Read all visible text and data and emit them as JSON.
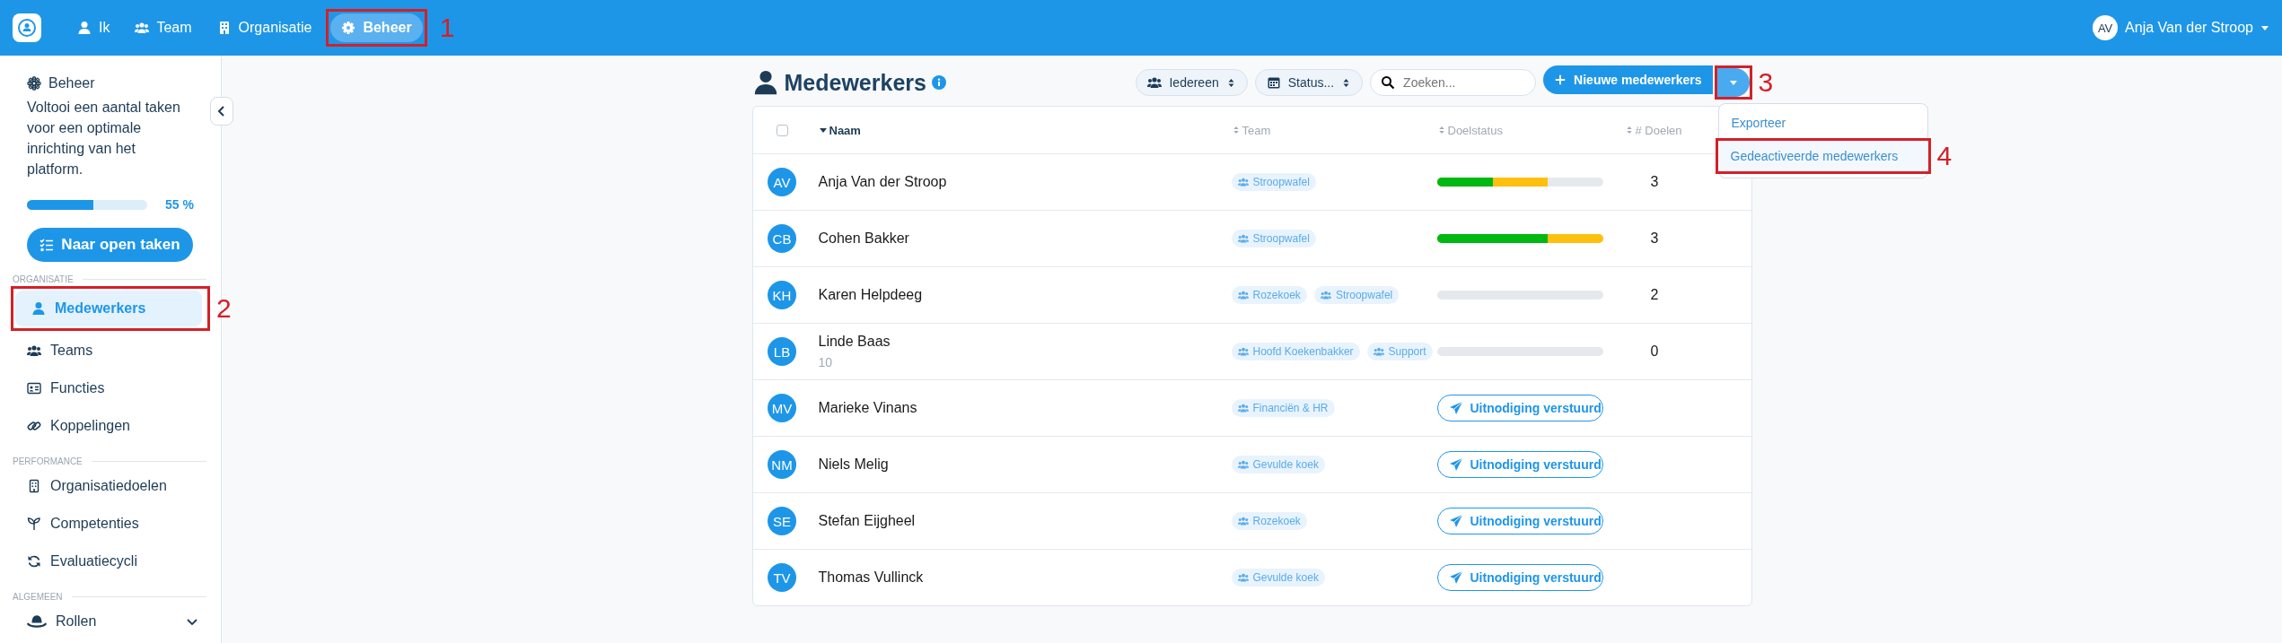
{
  "top_nav": {
    "items": [
      {
        "label": "Ik",
        "selected": false
      },
      {
        "label": "Team",
        "selected": false
      },
      {
        "label": "Organisatie",
        "selected": false
      },
      {
        "label": "Beheer",
        "selected": true,
        "callout": "1"
      }
    ],
    "user": {
      "initials": "AV",
      "name": "Anja Van der Stroop"
    }
  },
  "sidebar": {
    "heading": "Beheer",
    "intro": "Voltooi een aantal taken voor een optimale inrichting van het platform.",
    "progress": {
      "level": 0.55,
      "reading": "55 %"
    },
    "button": "Naar open taken",
    "sections": [
      {
        "title": "ORGANISATIE",
        "items": [
          {
            "label": "Medewerkers",
            "kind": "link",
            "selected": true,
            "callout": "2"
          },
          {
            "label": "Teams",
            "kind": "link",
            "selected": false
          },
          {
            "label": "Functies",
            "kind": "link",
            "selected": false
          },
          {
            "label": "Koppelingen",
            "kind": "link",
            "selected": false
          }
        ]
      },
      {
        "title": "PERFORMANCE",
        "items": [
          {
            "label": "Organisatiedoelen",
            "kind": "link",
            "selected": false
          },
          {
            "label": "Competenties",
            "kind": "link",
            "selected": false
          },
          {
            "label": "Evaluatiecycli",
            "kind": "link",
            "selected": false
          }
        ]
      },
      {
        "title": "ALGEMEEN",
        "items": [
          {
            "label": "Rollen",
            "kind": "group",
            "selected": false
          }
        ]
      }
    ]
  },
  "page": {
    "title": "Medewerkers",
    "filters": [
      {
        "label": "Iedereen"
      },
      {
        "label": "Status..."
      }
    ],
    "search": {
      "placeholder": "Zoeken..."
    },
    "new_button": "Nieuwe medewerkers",
    "split_callout": "3",
    "menu": [
      {
        "label": "Exporteer",
        "selected": false
      },
      {
        "label": "Gedeactiveerde medewerkers",
        "selected": true,
        "callout": "4"
      }
    ]
  },
  "table": {
    "select_all": {
      "checked": false
    },
    "columns": [
      {
        "label": "Naam",
        "sorted": true
      },
      {
        "label": "Team",
        "sorted": false
      },
      {
        "label": "Doelstatus",
        "sorted": false
      },
      {
        "label": "# Doelen",
        "sorted": false
      }
    ],
    "rows": [
      {
        "initials": "AV",
        "name": "Anja Van der Stroop",
        "teams": [
          "Stroopwafel"
        ],
        "status": {
          "kind": "progress",
          "achieved": {
            "level": 0.34
          },
          "in_progress": {
            "level": 0.67
          }
        },
        "goals": "3"
      },
      {
        "initials": "CB",
        "name": "Cohen Bakker",
        "teams": [
          "Stroopwafel"
        ],
        "status": {
          "kind": "progress",
          "achieved": {
            "level": 0.67
          },
          "in_progress": {
            "level": 1
          }
        },
        "goals": "3"
      },
      {
        "initials": "KH",
        "name": "Karen Helpdeeg",
        "teams": [
          "Rozekoek",
          "Stroopwafel"
        ],
        "status": {
          "kind": "progress"
        },
        "goals": "2"
      },
      {
        "initials": "LB",
        "name": "Linde Baas",
        "subtitle": "10",
        "teams": [
          "Hoofd Koekenbakker",
          "Support"
        ],
        "status": {
          "kind": "progress"
        },
        "goals": "0"
      },
      {
        "initials": "MV",
        "name": "Marieke Vinans",
        "teams": [
          "Financiën & HR"
        ],
        "status": {
          "kind": "invite",
          "label": "Uitnodiging verstuurd"
        }
      },
      {
        "initials": "NM",
        "name": "Niels Melig",
        "teams": [
          "Gevulde koek"
        ],
        "status": {
          "kind": "invite",
          "label": "Uitnodiging verstuurd"
        }
      },
      {
        "initials": "SE",
        "name": "Stefan Eijgheel",
        "teams": [
          "Rozekoek"
        ],
        "status": {
          "kind": "invite",
          "label": "Uitnodiging verstuurd"
        }
      },
      {
        "initials": "TV",
        "name": "Thomas Vullinck",
        "teams": [
          "Gevulde koek"
        ],
        "status": {
          "kind": "invite",
          "label": "Uitnodiging verstuurd"
        }
      }
    ]
  }
}
